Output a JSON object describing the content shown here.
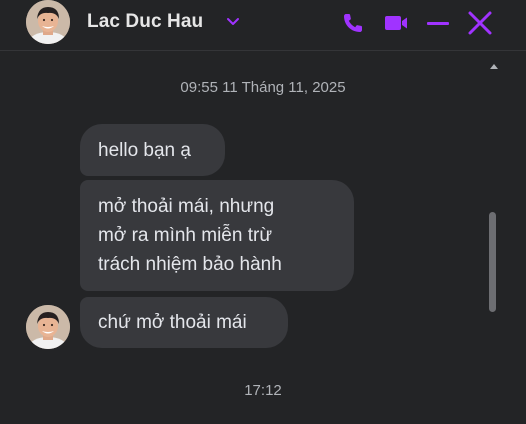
{
  "header": {
    "contact_name": "Lac Duc Hau",
    "icons": {
      "dropdown": "chevron-down-icon",
      "call": "phone-icon",
      "video": "video-camera-icon",
      "minimize": "minimize-icon",
      "close": "close-icon"
    },
    "accent_color": "#a033ff"
  },
  "chat": {
    "date_separator": "09:55 11 Tháng 11, 2025",
    "messages": [
      {
        "text": "hello bạn ạ"
      },
      {
        "lines": [
          "mở thoải mái, nhưng",
          "mở ra mình miễn trừ",
          "trách nhiệm bảo hành"
        ]
      },
      {
        "text": "chứ mở thoải mái"
      }
    ],
    "time_separator": "17:12"
  },
  "colors": {
    "background": "#232426",
    "bubble": "#38393d",
    "text": "#e4e6eb",
    "muted_text": "#b0b3b8"
  }
}
